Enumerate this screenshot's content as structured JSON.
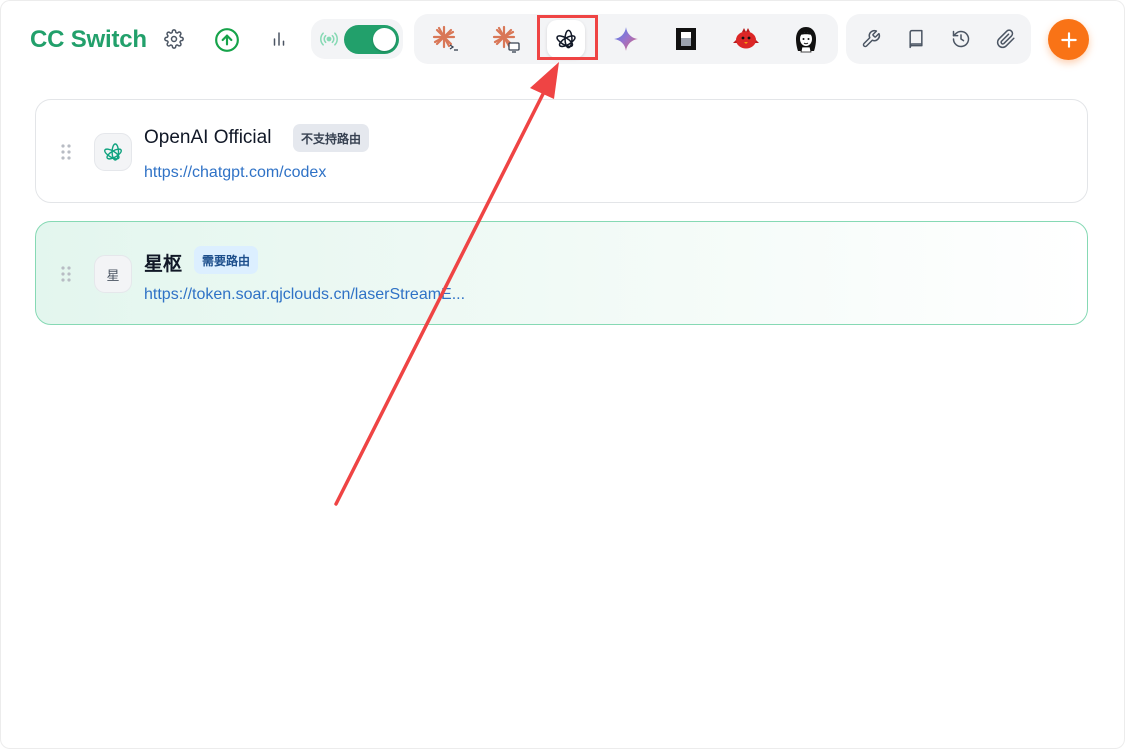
{
  "app": {
    "title": "CC Switch"
  },
  "header": {
    "settings_icon": "gear-icon",
    "update_icon": "arrow-up-circle-icon",
    "usage_icon": "bar-chart-icon",
    "proxy_icon": "broadcast-icon",
    "proxy_enabled": true
  },
  "apps": [
    {
      "name": "claude-code",
      "icon": "claude-terminal-icon"
    },
    {
      "name": "claude-desktop",
      "icon": "claude-desktop-icon"
    },
    {
      "name": "codex",
      "icon": "openai-icon",
      "active": true
    },
    {
      "name": "gemini",
      "icon": "gemini-sparkle-icon"
    },
    {
      "name": "opencode",
      "icon": "opencode-icon"
    },
    {
      "name": "red-bird",
      "icon": "red-bird-icon"
    },
    {
      "name": "avatar-app",
      "icon": "girl-avatar-icon"
    }
  ],
  "tools": [
    {
      "icon": "wrench-icon"
    },
    {
      "icon": "book-icon"
    },
    {
      "icon": "history-icon"
    },
    {
      "icon": "paperclip-icon"
    }
  ],
  "add_icon": "plus-icon",
  "providers": [
    {
      "name": "OpenAI Official",
      "badge": "不支持路由",
      "url": "https://chatgpt.com/codex",
      "avatar_icon": "openai-icon",
      "active": false
    },
    {
      "name": "星枢",
      "badge": "需要路由",
      "url": "https://token.soar.qjclouds.cn/laserStreamE...",
      "avatar_text": "星",
      "active": true
    }
  ],
  "colors": {
    "brand_green": "#22a06b",
    "accent_orange": "#f97316",
    "link_blue": "#2f72c6",
    "annotation_red": "#ef4444"
  }
}
